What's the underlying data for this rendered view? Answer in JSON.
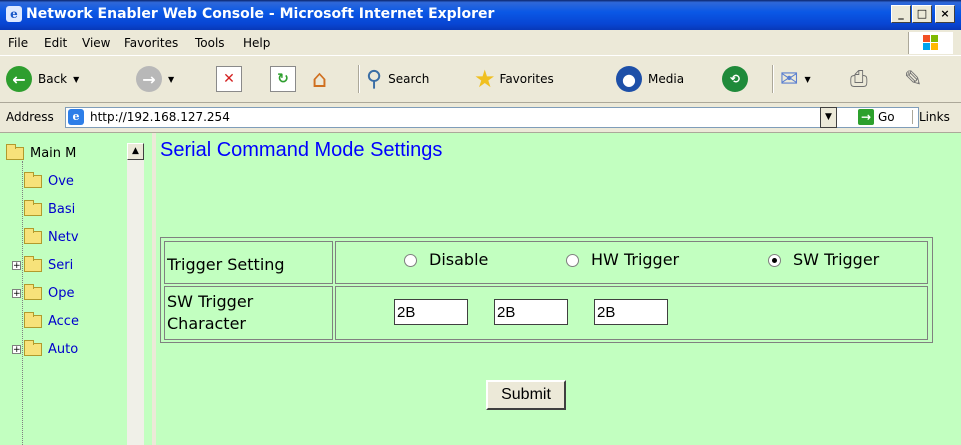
{
  "window": {
    "title": "Network Enabler Web Console - Microsoft Internet Explorer",
    "minimize": "_",
    "maximize": "□",
    "close": "×"
  },
  "menu": [
    "File",
    "Edit",
    "View",
    "Favorites",
    "Tools",
    "Help"
  ],
  "toolbar": {
    "back_label": "Back",
    "search_label": "Search",
    "favorites_label": "Favorites",
    "media_label": "Media"
  },
  "address": {
    "label": "Address",
    "url": "http://192.168.127.254",
    "go_label": "Go",
    "links_label": "Links"
  },
  "sidebar": {
    "items": [
      {
        "label": "Main M"
      },
      {
        "label": "Ove"
      },
      {
        "label": "Basi"
      },
      {
        "label": "Netv"
      },
      {
        "label": "Seri"
      },
      {
        "label": "Ope"
      },
      {
        "label": "Acce"
      },
      {
        "label": "Auto"
      }
    ]
  },
  "main": {
    "title": "Serial Command Mode Settings",
    "trigger_label": "Trigger Setting",
    "options": [
      "Disable",
      "HW Trigger",
      "SW Trigger"
    ],
    "selected_option": "SW Trigger",
    "sw_char_label_line1": "SW Trigger",
    "sw_char_label_line2": "Character",
    "char_values": [
      "2B",
      "2B",
      "2B"
    ],
    "submit_label": "Submit"
  },
  "colors": {
    "content_bg": "#c2ffc0",
    "title_blue": "#0000ff",
    "titlebar": "#0845d3"
  }
}
